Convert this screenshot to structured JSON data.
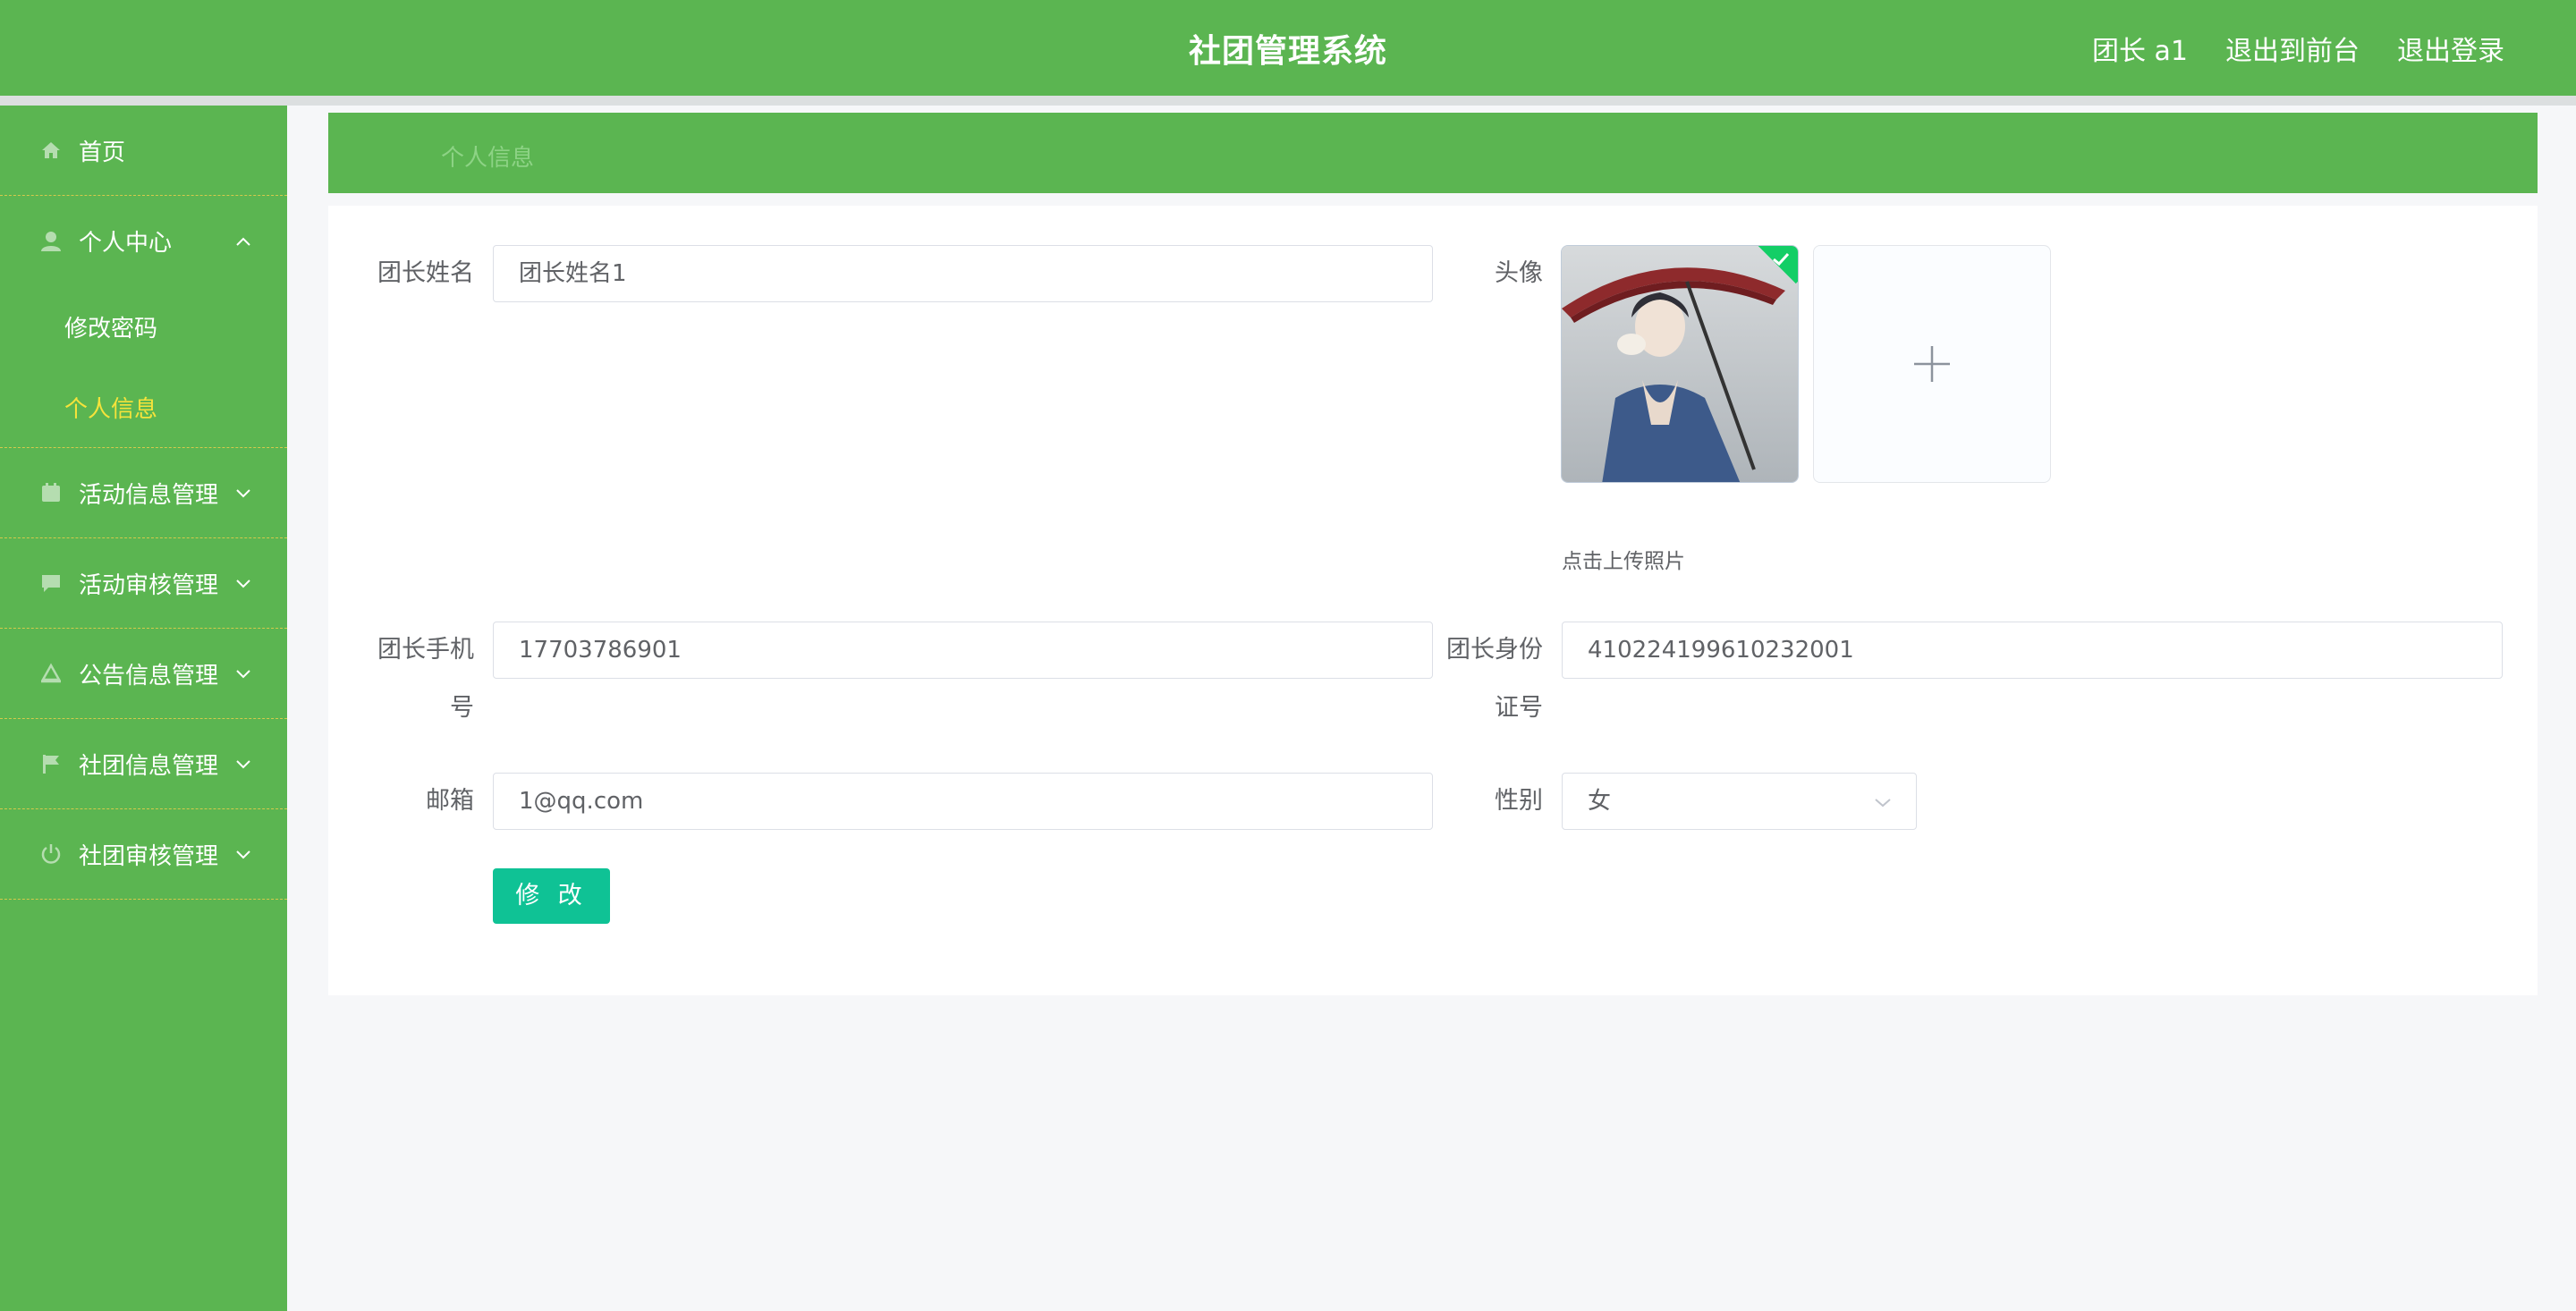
{
  "header": {
    "title": "社团管理系统",
    "user": "团长 a1",
    "to_front": "退出到前台",
    "logout": "退出登录"
  },
  "sidebar": {
    "items": [
      {
        "label": "首页",
        "icon": "home-icon"
      },
      {
        "label": "个人中心",
        "icon": "user-icon",
        "expanded": true,
        "children": [
          {
            "label": "修改密码"
          },
          {
            "label": "个人信息",
            "active": true
          }
        ]
      },
      {
        "label": "活动信息管理",
        "icon": "calendar-icon"
      },
      {
        "label": "活动审核管理",
        "icon": "chat-icon"
      },
      {
        "label": "公告信息管理",
        "icon": "megaphone-icon"
      },
      {
        "label": "社团信息管理",
        "icon": "flag-icon"
      },
      {
        "label": "社团审核管理",
        "icon": "power-icon"
      }
    ]
  },
  "breadcrumb": "个人信息",
  "form": {
    "name_label": "团长姓名",
    "name_value": "团长姓名1",
    "avatar_label": "头像",
    "upload_hint": "点击上传照片",
    "phone_label_1": "团长手机",
    "phone_label_2": "号",
    "phone_value": "17703786901",
    "id_label_1": "团长身份",
    "id_label_2": "证号",
    "id_value": "410224199610232001",
    "email_label": "邮箱",
    "email_value": "1@qq.com",
    "gender_label": "性别",
    "gender_value": "女",
    "submit_label": "修 改"
  },
  "colors": {
    "primary_green": "#5bb551",
    "active_menu": "#f5e33b",
    "button": "#0fc295",
    "success_badge": "#13ce66"
  }
}
